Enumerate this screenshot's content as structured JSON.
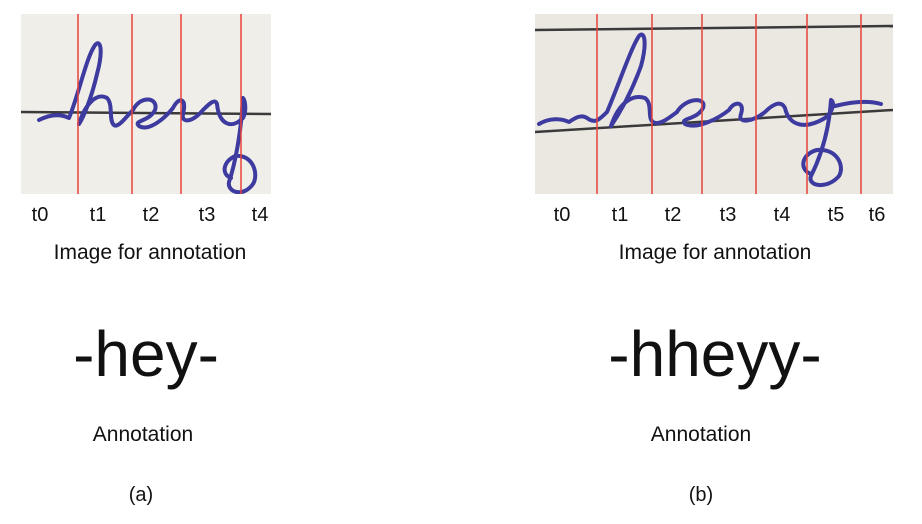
{
  "panel_a": {
    "ticks": [
      "t0",
      "t1",
      "t2",
      "t3",
      "t4"
    ],
    "image_caption": "Image for annotation",
    "annotation": "-hey-",
    "annotation_label": "Annotation",
    "label": "(a)",
    "handwriting_word": "hey"
  },
  "panel_b": {
    "ticks": [
      "t0",
      "t1",
      "t2",
      "t3",
      "t4",
      "t5",
      "t6"
    ],
    "image_caption": "Image for annotation",
    "annotation": "-hheyy-",
    "annotation_label": "Annotation",
    "label": "(b)",
    "handwriting_word": "hey"
  },
  "colors": {
    "divider": "#e8433b",
    "ink": "#3d3aa0",
    "paper_a": "#f0eee8",
    "paper_b": "#ebe8e1",
    "ruled_line": "#3a3a3a"
  }
}
